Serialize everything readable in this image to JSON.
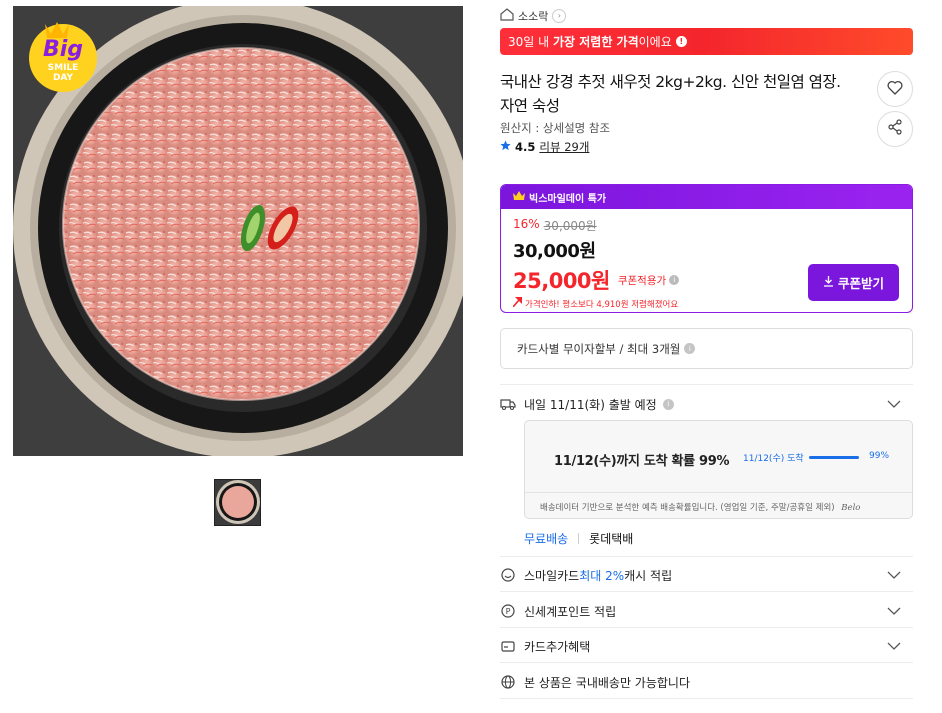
{
  "gallery": {
    "badge_line1": "Big",
    "badge_line2": "SMILE",
    "badge_line3": "DAY"
  },
  "store": {
    "name": "소소락"
  },
  "banner": {
    "prefix": "30일 내 ",
    "bold": "가장 저렴한 가격",
    "suffix": "이에요"
  },
  "product": {
    "title": "국내산 강경 추젓 새우젓 2kg+2kg. 신안 천일염 염장. 자연 숙성",
    "origin": "원산지 : 상세설명 참조",
    "rating": "4.5",
    "reviews": "리뷰 29개"
  },
  "deal": {
    "header": "빅스마일데이 특가",
    "discount_pct": "16%",
    "original_price": "30,000원",
    "price": "30,000원",
    "coupon_price": "25,000원",
    "coupon_label": "쿠폰적용가",
    "price_drop_note": "가격인하! 평소보다 4,910원 저렴해졌어요",
    "coupon_button": "쿠폰받기"
  },
  "installment": {
    "text": "카드사별 무이자할부 / 최대 3개월"
  },
  "delivery": {
    "title": "내일 11/11(화) 출발 예정",
    "arrival_text": "11/12(수)까지 도착 확률 99%",
    "arrival_mini": "11/12(수) 도착",
    "arrival_pct": "99%",
    "arrival_probability": 0.99,
    "note": "배송데이터 기반으로 분석한 예측 배송확률입니다. (영업일 기준, 주말/공휴일 제외)",
    "note_tail": "Belo",
    "free_shipping": "무료배송",
    "carrier": "롯데택배"
  },
  "benefits": [
    {
      "pre": "스마일카드 ",
      "highlight": "최대 2%",
      "post": " 캐시 적립"
    },
    {
      "pre": "신세계포인트 적립",
      "highlight": "",
      "post": ""
    },
    {
      "pre": "카드추가혜택",
      "highlight": "",
      "post": ""
    },
    {
      "pre": "본 상품은 국내배송만 가능합니다",
      "highlight": "",
      "post": ""
    }
  ],
  "colors": {
    "accent_red": "#f4262c",
    "accent_purple": "#7b16dd",
    "accent_blue": "#1a6ee8"
  }
}
